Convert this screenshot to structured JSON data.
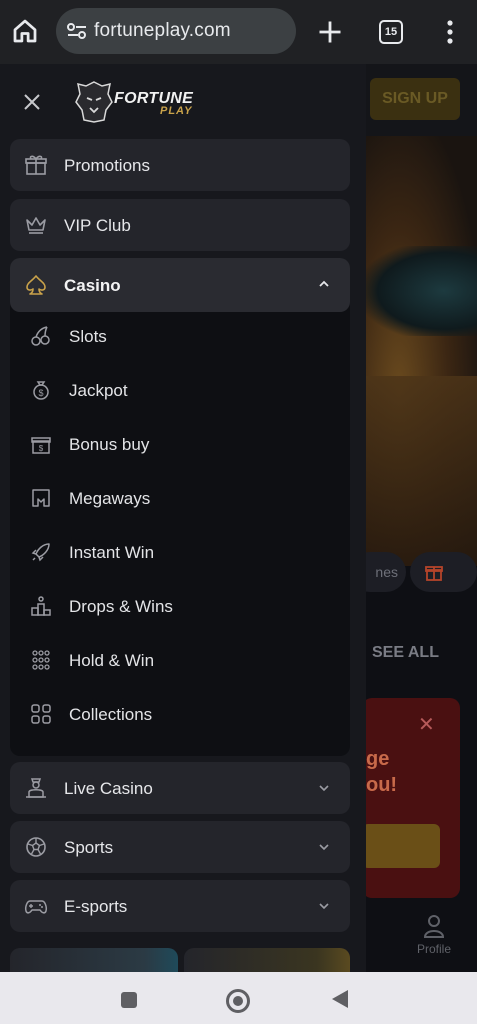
{
  "browser": {
    "url": "fortuneplay.com",
    "tab_count": "15"
  },
  "site": {
    "signup_label": "SIGN UP",
    "chip_partial": "nes",
    "see_all": "SEE ALL",
    "promo_partial_text": "ge\nou!",
    "profile_label": "Profile"
  },
  "logo": {
    "word1": "FORTUNE",
    "word2": "PLAY"
  },
  "menu": {
    "promotions": "Promotions",
    "vip": "VIP Club",
    "casino": "Casino",
    "casino_items": [
      {
        "label": "Slots",
        "icon": "cherries-icon"
      },
      {
        "label": "Jackpot",
        "icon": "money-bag-icon"
      },
      {
        "label": "Bonus buy",
        "icon": "bonus-gift-icon"
      },
      {
        "label": "Megaways",
        "icon": "megaways-icon"
      },
      {
        "label": "Instant Win",
        "icon": "rocket-icon"
      },
      {
        "label": "Drops & Wins",
        "icon": "podium-icon"
      },
      {
        "label": "Hold & Win",
        "icon": "dots-grid-icon"
      },
      {
        "label": "Collections",
        "icon": "squares-grid-icon"
      }
    ],
    "live_casino": "Live Casino",
    "sports": "Sports",
    "esports": "E-sports"
  },
  "colors": {
    "drawer_bg": "#17181d",
    "card_bg": "#24252b",
    "icon_stroke": "#9b9ca3",
    "accent_gold": "#c9a24a"
  }
}
